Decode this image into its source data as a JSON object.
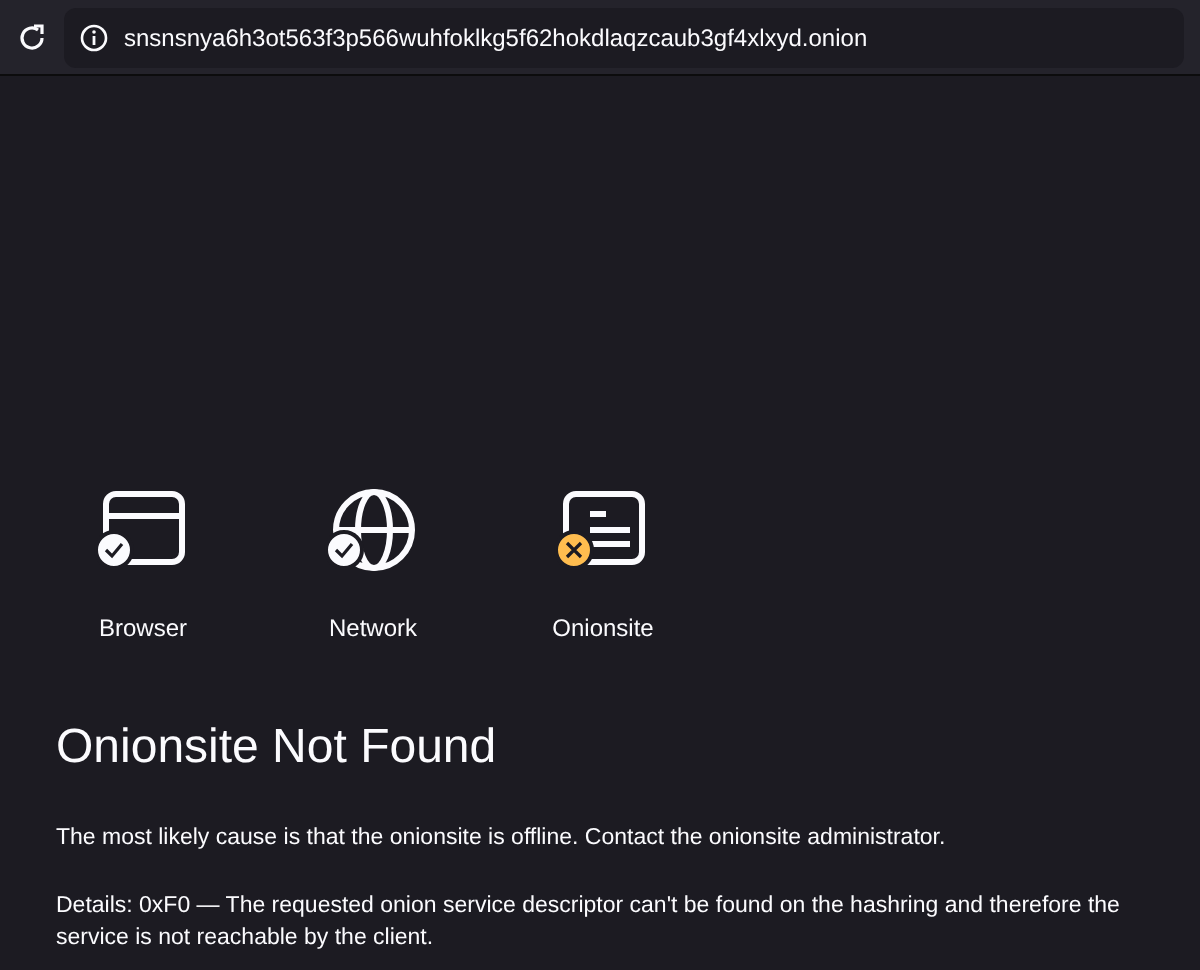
{
  "address_bar": {
    "url": "snsnsnya6h3ot563f3p566wuhfoklkg5f62hokdlaqzcaub3gf4xlxyd.onion"
  },
  "diagnostics": [
    {
      "kind": "browser",
      "label": "Browser",
      "passed": true
    },
    {
      "kind": "network",
      "label": "Network",
      "passed": true
    },
    {
      "kind": "site",
      "label": "Onionsite",
      "passed": false
    }
  ],
  "title": "Onionsite Not Found",
  "paragraphs": [
    "The most likely cause is that the onionsite is offline. Contact the onionsite administrator.",
    "Details: 0xF0 — The requested onion service descriptor can't be found on the hashring and therefore the service is not reachable by the client."
  ]
}
